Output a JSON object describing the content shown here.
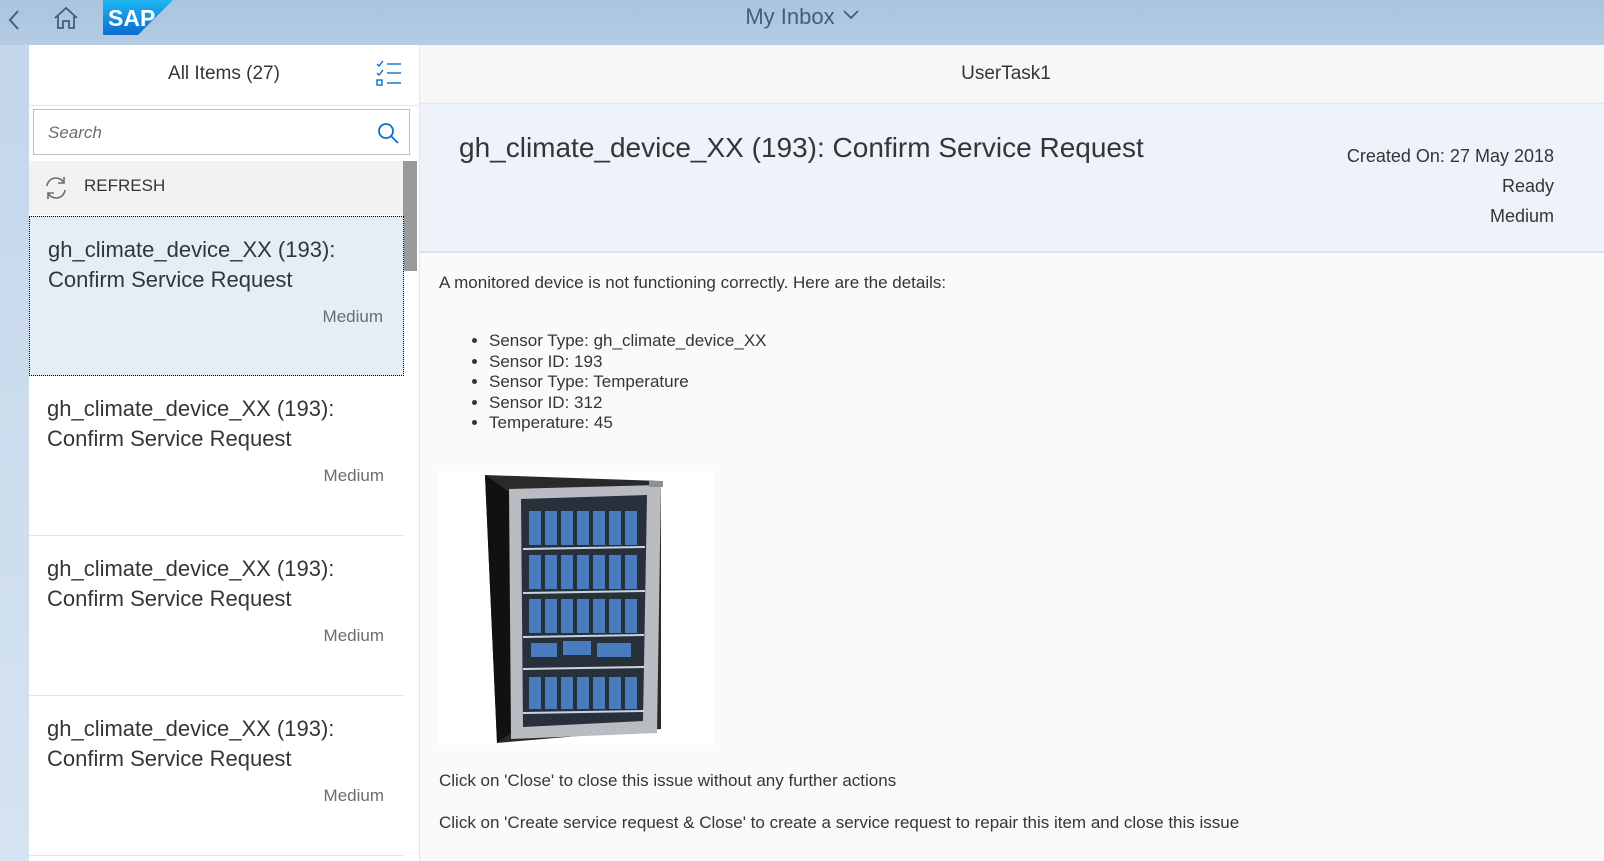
{
  "shell": {
    "title": "My Inbox",
    "logo_text": "SAP",
    "icons": {
      "back": "chevron-left-icon",
      "home": "home-icon",
      "title_dropdown": "chevron-down-icon"
    },
    "brand_color": "#0a6ed1"
  },
  "master": {
    "header": "All Items (27)",
    "search": {
      "placeholder": "Search",
      "value": ""
    },
    "refresh_label": "REFRESH",
    "items": [
      {
        "title": "gh_climate_device_XX (193): Confirm Service Request",
        "priority": "Medium",
        "selected": true
      },
      {
        "title": "gh_climate_device_XX (193): Confirm Service Request",
        "priority": "Medium",
        "selected": false
      },
      {
        "title": "gh_climate_device_XX (193): Confirm Service Request",
        "priority": "Medium",
        "selected": false
      },
      {
        "title": "gh_climate_device_XX (193): Confirm Service Request",
        "priority": "Medium",
        "selected": false
      }
    ]
  },
  "detail": {
    "page_title": "UserTask1",
    "object_title": "gh_climate_device_XX (193): Confirm Service Request",
    "created_on": "Created On: 27 May 2018",
    "status": "Ready",
    "priority": "Medium",
    "description": "A monitored device is not functioning correctly. Here are the details:",
    "details": [
      "Sensor Type: gh_climate_device_XX",
      "Sensor ID: 193",
      "Sensor Type: Temperature",
      "Sensor ID: 312",
      "Temperature: 45"
    ],
    "note_close": "Click on 'Close' to close this issue without any further actions",
    "note_create": "Click on 'Create service request & Close' to create a service request to repair this item and close this issue"
  }
}
